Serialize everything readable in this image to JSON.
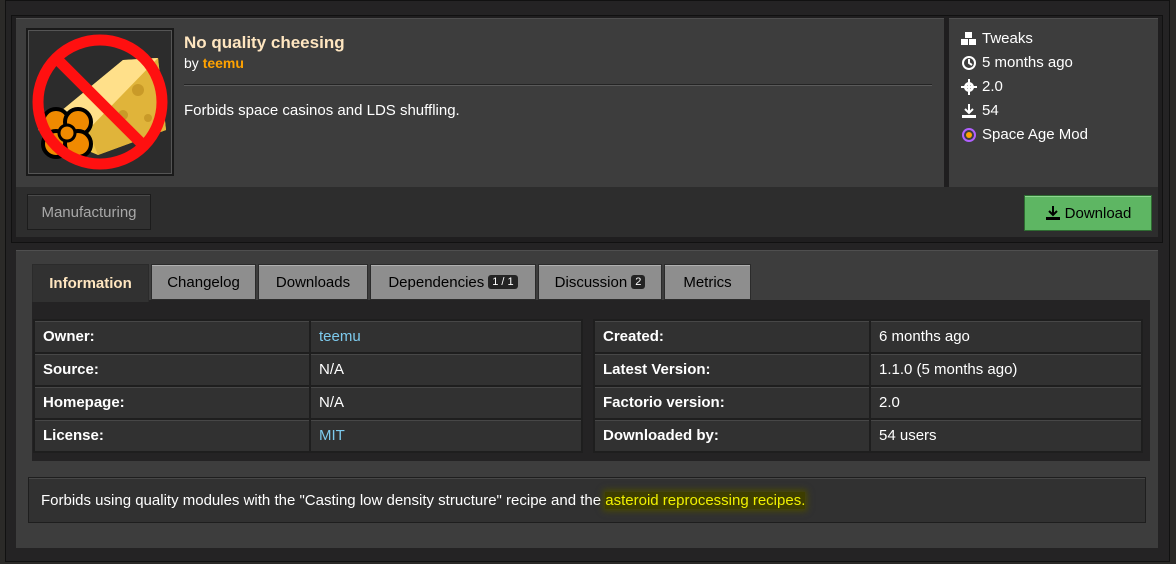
{
  "mod": {
    "title": "No quality cheesing",
    "by_label": "by",
    "author": "teemu",
    "summary": "Forbids space casinos and LDS shuffling."
  },
  "meta": {
    "category": "Tweaks",
    "updated": "5 months ago",
    "factorio_version": "2.0",
    "downloads": "54",
    "dlc": "Space Age Mod"
  },
  "tag": "Manufacturing",
  "download_label": "Download",
  "tabs": [
    {
      "label": "Information"
    },
    {
      "label": "Changelog"
    },
    {
      "label": "Downloads"
    },
    {
      "label": "Dependencies",
      "badge": "1 / 1"
    },
    {
      "label": "Discussion",
      "badge": "2"
    },
    {
      "label": "Metrics"
    }
  ],
  "info_left": [
    {
      "key": "Owner:",
      "value": "teemu"
    },
    {
      "key": "Source:",
      "value": "N/A"
    },
    {
      "key": "Homepage:",
      "value": "N/A"
    },
    {
      "key": "License:",
      "value": "MIT"
    }
  ],
  "info_right": [
    {
      "key": "Created:",
      "value": "6 months ago"
    },
    {
      "key": "Latest Version:",
      "value": "1.1.0 (5 months ago)"
    },
    {
      "key": "Factorio version:",
      "value": "2.0"
    },
    {
      "key": "Downloaded by:",
      "value": "54 users"
    }
  ],
  "description": {
    "text": "Forbids using quality modules with the \"Casting low density structure\" recipe and the ",
    "highlight": "asteroid reprocessing recipes."
  },
  "colors": {
    "title": "#ffe6c0",
    "author": "#ffa200",
    "link": "#7dcaed",
    "download_bg": "#5eb663",
    "highlight": "#f0f000"
  }
}
